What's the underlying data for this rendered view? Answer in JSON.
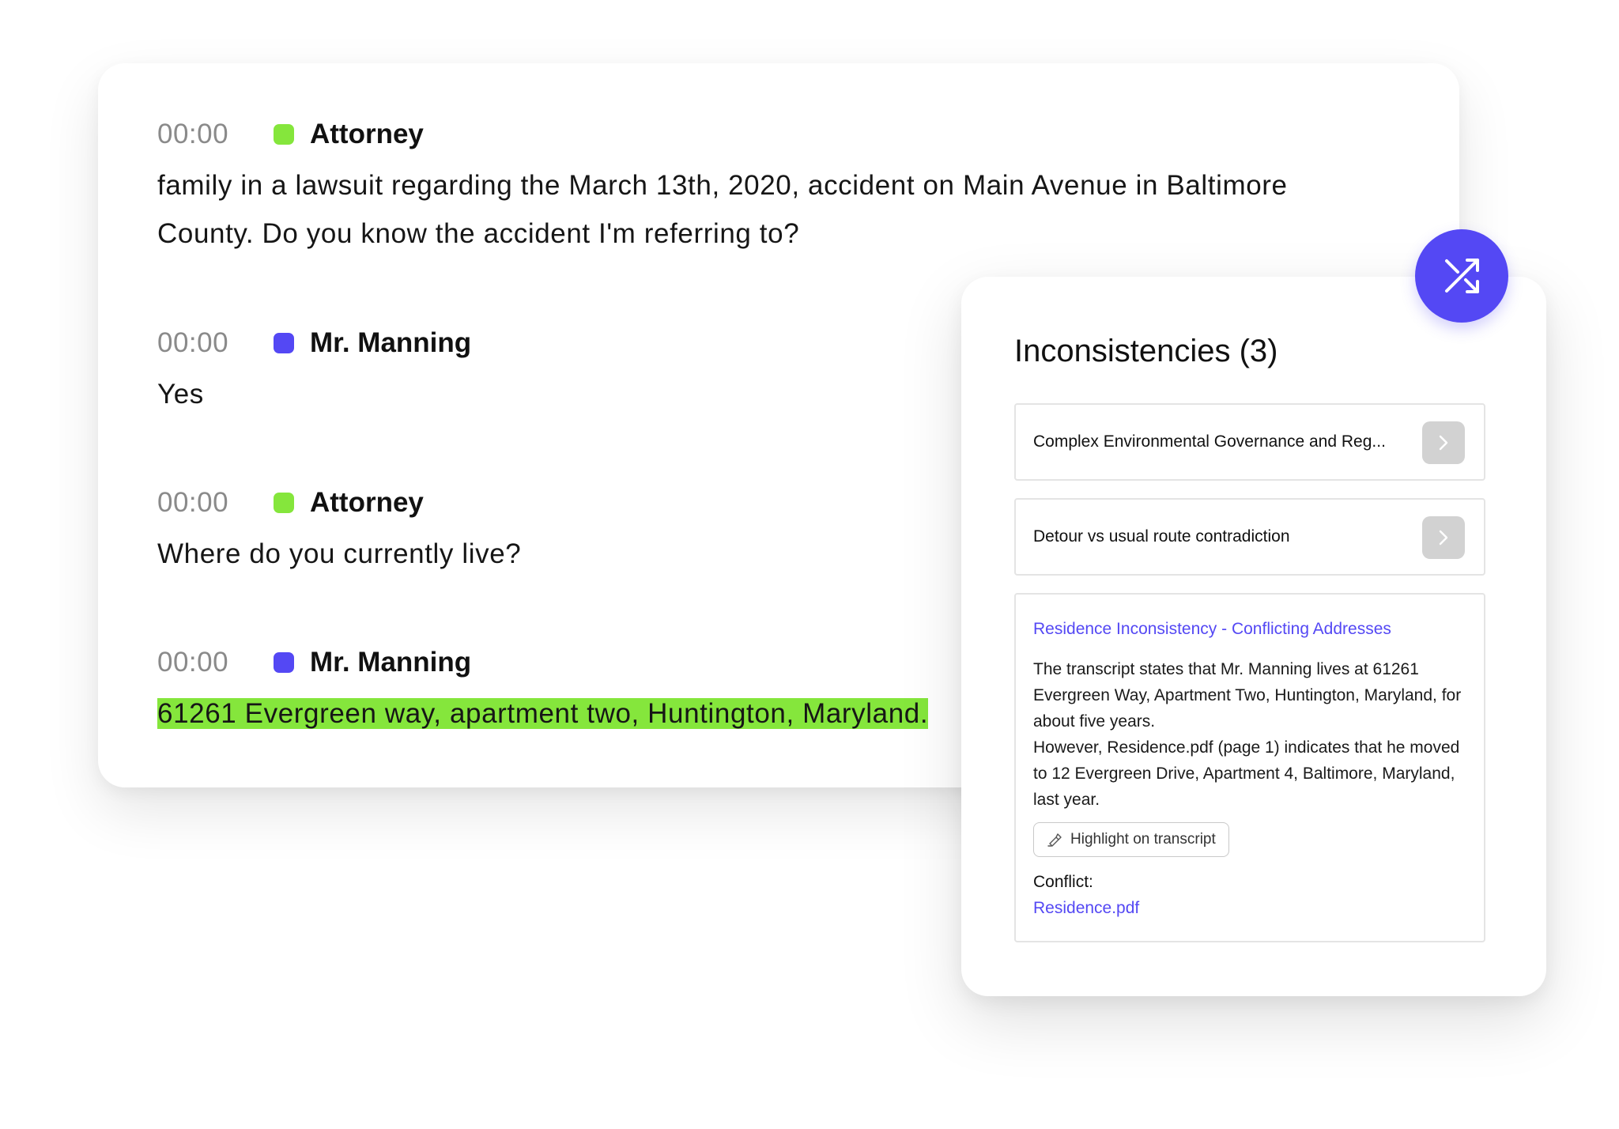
{
  "colors": {
    "attorney": "#85e63c",
    "witness": "#5448f4",
    "highlight": "#85e63c",
    "accent": "#5448f4"
  },
  "transcript": {
    "entries": [
      {
        "time": "00:00",
        "speaker": "Attorney",
        "lines": [
          "family in a lawsuit regarding the March 13th, 2020, accident on Main Avenue in Baltimore",
          "County. Do you know the accident I'm referring to?"
        ]
      },
      {
        "time": "00:00",
        "speaker": "Mr. Manning",
        "lines": [
          "Yes"
        ]
      },
      {
        "time": "00:00",
        "speaker": "Attorney",
        "lines": [
          "Where do you currently live?"
        ]
      },
      {
        "time": "00:00",
        "speaker": "Mr. Manning",
        "lines": [
          "61261 Evergreen way, apartment two, Huntington, Maryland."
        ]
      }
    ]
  },
  "panel": {
    "title": "Inconsistencies (3)",
    "shuffle_icon": "shuffle-icon",
    "items": [
      {
        "label": "Complex Environmental Governance and Reg...",
        "icon": "chevron-right-icon"
      },
      {
        "label": "Detour vs usual route contradiction",
        "icon": "chevron-right-icon"
      }
    ],
    "detail": {
      "title": "Residence Inconsistency - Conflicting Addresses",
      "paragraph1": "The transcript states that Mr. Manning lives at 61261 Evergreen Way, Apartment Two, Huntington, Maryland, for about five years.",
      "paragraph2": "However, Residence.pdf (page 1) indicates that he moved to 12 Evergreen Drive, Apartment 4, Baltimore, Maryland, last year.",
      "highlight_button": "Highlight on transcript",
      "highlight_icon": "highlighter-icon",
      "conflict_label": "Conflict:",
      "conflict_file": "Residence.pdf"
    }
  }
}
